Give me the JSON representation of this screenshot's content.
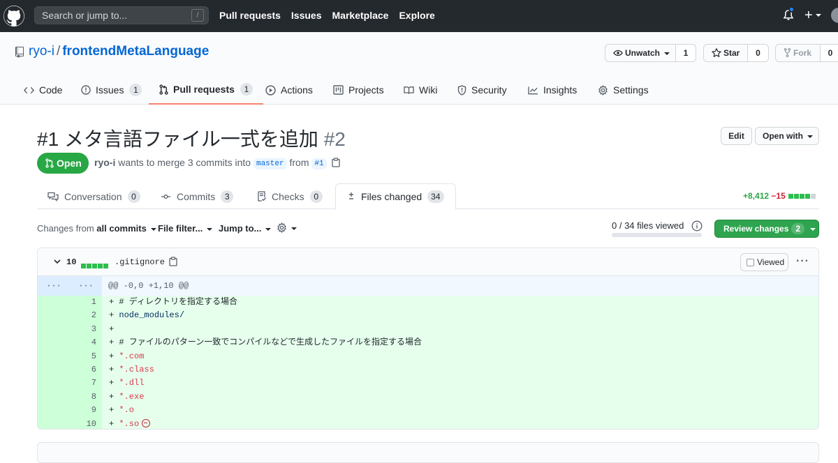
{
  "topbar": {
    "search_placeholder": "Search or jump to...",
    "search_shortcut": "/",
    "nav": [
      "Pull requests",
      "Issues",
      "Marketplace",
      "Explore"
    ],
    "plus": "+"
  },
  "repo": {
    "owner": "ryo-i",
    "separator": "/",
    "name": "frontendMetaLanguage",
    "unwatch_label": "Unwatch",
    "watch_count": "1",
    "star_label": "Star",
    "star_count": "0",
    "fork_label": "Fork",
    "fork_count": "0"
  },
  "repo_tabs": [
    {
      "label": "Code"
    },
    {
      "label": "Issues",
      "count": "1"
    },
    {
      "label": "Pull requests",
      "count": "1"
    },
    {
      "label": "Actions"
    },
    {
      "label": "Projects"
    },
    {
      "label": "Wiki"
    },
    {
      "label": "Security"
    },
    {
      "label": "Insights"
    },
    {
      "label": "Settings"
    }
  ],
  "pr": {
    "title": "#1 メタ言語ファイル一式を追加",
    "number": "#2",
    "edit_label": "Edit",
    "open_with_label": "Open with",
    "state": "Open",
    "author": "ryo-i",
    "merge_text_1": "wants to merge 3 commits into",
    "base_branch": "master",
    "merge_text_2": "from",
    "head_branch": "#1"
  },
  "pr_tabs": [
    {
      "label": "Conversation",
      "count": "0"
    },
    {
      "label": "Commits",
      "count": "3"
    },
    {
      "label": "Checks",
      "count": "0"
    },
    {
      "label": "Files changed",
      "count": "34"
    }
  ],
  "diffstat": {
    "additions": "+8,412",
    "deletions": "−15"
  },
  "toolbar": {
    "changes_from_prefix": "Changes from",
    "changes_from_value": "all commits",
    "file_filter": "File filter...",
    "jump_to": "Jump to...",
    "files_viewed": "0 / 34 files viewed",
    "files_viewed_fraction": 0,
    "review_label": "Review changes",
    "review_count": "2"
  },
  "file": {
    "lines_changed": "10",
    "name": ".gitignore",
    "viewed_label": "Viewed",
    "more": "···",
    "hunk_expand_left": "···",
    "hunk_expand_right": "···",
    "hunk_header": "@@ -0,0 +1,10 @@",
    "lines": [
      {
        "num": "1",
        "sign": "+",
        "text": "# ディレクトリを指定する場合"
      },
      {
        "num": "2",
        "sign": "+",
        "text": "node_modules/"
      },
      {
        "num": "3",
        "sign": "+",
        "text": ""
      },
      {
        "num": "4",
        "sign": "+",
        "text": "# ファイルのパターン一致でコンパイルなどで生成したファイルを指定する場合"
      },
      {
        "num": "5",
        "sign": "+",
        "text": "*.com"
      },
      {
        "num": "6",
        "sign": "+",
        "text": "*.class"
      },
      {
        "num": "7",
        "sign": "+",
        "text": "*.dll"
      },
      {
        "num": "8",
        "sign": "+",
        "text": "*.exe"
      },
      {
        "num": "9",
        "sign": "+",
        "text": "*.o"
      },
      {
        "num": "10",
        "sign": "+",
        "text": "*.so"
      }
    ]
  },
  "colors": {
    "accent_green": "#2ea44f",
    "tab_underline": "#f9826c",
    "link": "#0366d6"
  }
}
